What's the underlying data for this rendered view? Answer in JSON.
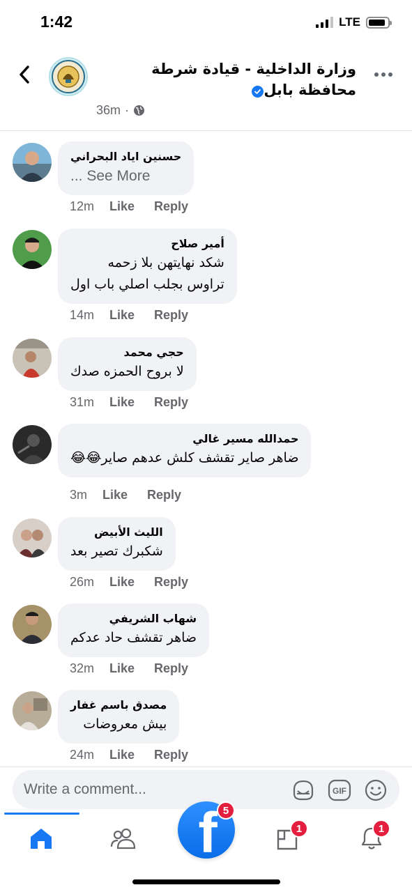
{
  "status_bar": {
    "time": "1:42",
    "network": "LTE",
    "signal_bars": 3,
    "signal_bars_total": 4,
    "battery_level": 0.9
  },
  "header": {
    "page_name": "وزارة الداخلية - قيادة شرطة محافظة بابل",
    "verified": true,
    "post_time": "36m",
    "audience_icon": "globe-icon",
    "separator": "·"
  },
  "comments": [
    {
      "name": "حسنين اياد البحراني",
      "text": "... See More",
      "text_ltr": true,
      "time": "12m",
      "like": "Like",
      "reply": "Reply",
      "avatar_color": "#7fa9c4"
    },
    {
      "name": "أمير صلاح",
      "text": "شكد نهايتهن بلا زحمه",
      "text2": "تراوس بجلب اصلي باب اول",
      "time": "14m",
      "like": "Like",
      "reply": "Reply",
      "avatar_color": "#4f9c4a"
    },
    {
      "name": "حجي محمد",
      "text": "لا بروح الحمزه صدك",
      "time": "31m",
      "like": "Like",
      "reply": "Reply",
      "avatar_color": "#b8b0a4"
    },
    {
      "name": "حمدالله مسير غالي",
      "text": "ضاهر صاير تقشف كلش عدهم صاير😂😂",
      "time": "3m",
      "like": "Like",
      "reply": "Reply",
      "avatar_color": "#2e2e2e"
    },
    {
      "name": "الليث الأبيض",
      "text": "شكبرك تصير بعد",
      "time": "26m",
      "like": "Like",
      "reply": "Reply",
      "avatar_color": "#c9b7ae"
    },
    {
      "name": "شهاب الشريفي",
      "text": "ضاهر تقشف حاد عدكم",
      "time": "32m",
      "like": "Like",
      "reply": "Reply",
      "avatar_color": "#8a7a5c"
    },
    {
      "name": "مصدق باسم غفار",
      "text": "بيش معروضات",
      "time": "24m",
      "like": "Like",
      "reply": "Reply",
      "avatar_color": "#a39988"
    }
  ],
  "composer": {
    "placeholder": "Write a comment...",
    "icons": [
      "sticker-icon",
      "gif-icon",
      "emoji-icon"
    ],
    "gif_label": "GIF"
  },
  "bottom_nav": {
    "items": [
      "home-icon",
      "friends-icon",
      "facebook-icon",
      "pages-icon",
      "notifications-icon"
    ],
    "badges": {
      "facebook": "5",
      "pages": "1",
      "notifications": "1"
    },
    "fb_letter": "f",
    "accent": "#1877f2"
  }
}
